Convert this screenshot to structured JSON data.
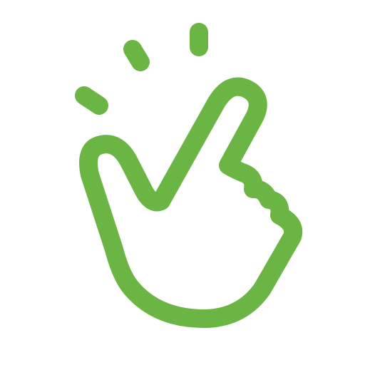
{
  "icon": {
    "name": "finger-snap-icon",
    "color": "#6bb545",
    "background": "#ffffff"
  }
}
